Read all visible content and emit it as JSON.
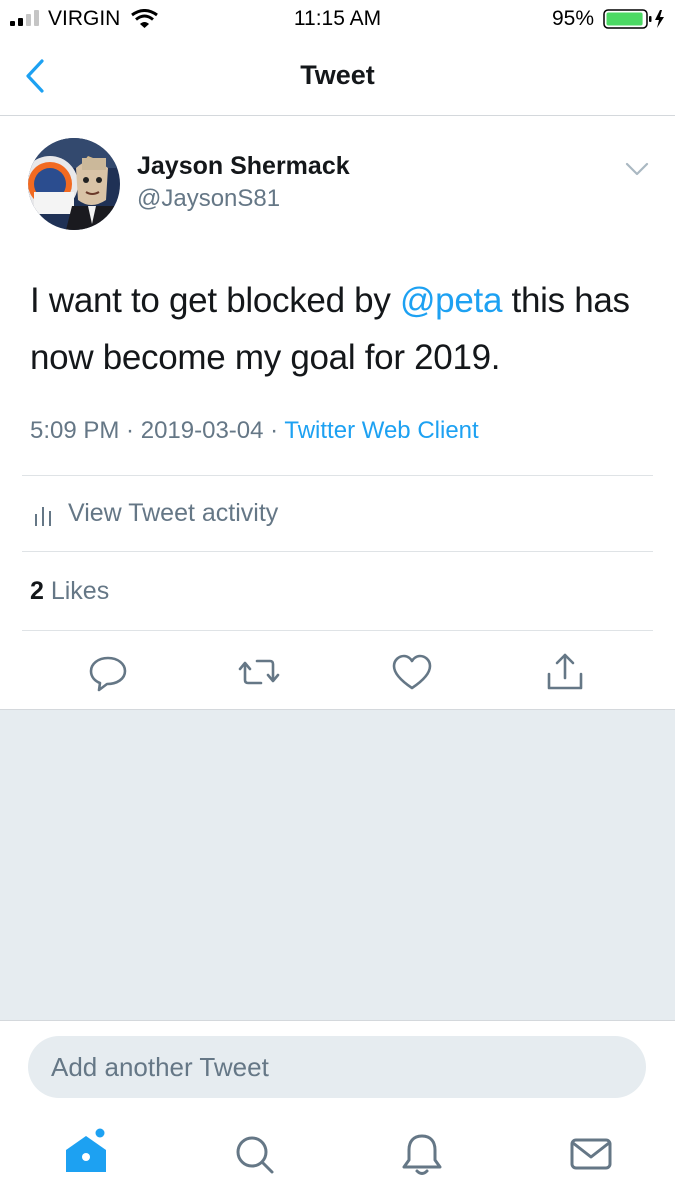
{
  "status_bar": {
    "carrier": "VIRGIN",
    "time": "11:15 AM",
    "battery_pct": "95%",
    "battery_level": 0.95
  },
  "nav": {
    "title": "Tweet"
  },
  "tweet": {
    "author_name": "Jayson Shermack",
    "author_handle": "@JaysonS81",
    "text_before": "I want to get blocked by ",
    "mention": "@peta",
    "text_after": " this has now become my goal for 2019.",
    "time": "5:09 PM",
    "date": "2019-03-04",
    "sep": " · ",
    "source": "Twitter Web Client",
    "view_activity": "View Tweet activity",
    "likes_count": "2",
    "likes_label": " Likes"
  },
  "composer": {
    "placeholder": "Add another Tweet"
  },
  "colors": {
    "accent": "#1da1f2",
    "text": "#14171a",
    "secondary": "#657786",
    "background_gray": "#e6ecf0"
  },
  "icons": [
    "back-chevron-icon",
    "chevron-down-icon",
    "bar-chart-icon",
    "reply-icon",
    "retweet-icon",
    "like-icon",
    "share-icon",
    "home-icon",
    "search-icon",
    "notifications-icon",
    "messages-icon"
  ]
}
